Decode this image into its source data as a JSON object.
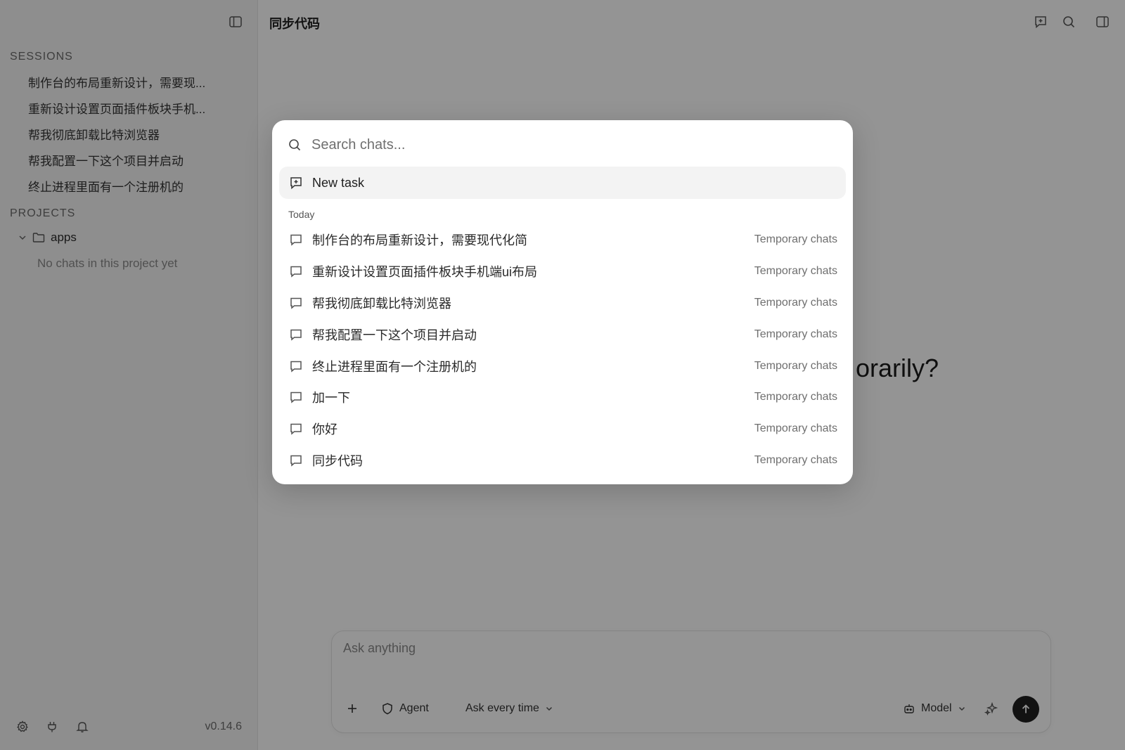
{
  "sidebar": {
    "sessions_title": "SESSIONS",
    "sessions": [
      {
        "title": "制作台的布局重新设计，需要现..."
      },
      {
        "title": "重新设计设置页面插件板块手机..."
      },
      {
        "title": "帮我彻底卸载比特浏览器"
      },
      {
        "title": "帮我配置一下这个项目并启动"
      },
      {
        "title": "终止进程里面有一个注册机的"
      }
    ],
    "projects_title": "PROJECTS",
    "project": {
      "name": "apps",
      "empty_text": "No chats in this project yet"
    },
    "version": "v0.14.6"
  },
  "main": {
    "title": "同步代码",
    "background_heading_fragment": "orarily?",
    "composer": {
      "placeholder": "Ask anything",
      "agent_label": "Agent",
      "permission_label": "Ask every time",
      "model_label": "Model"
    }
  },
  "search_modal": {
    "placeholder": "Search chats...",
    "new_task_label": "New task",
    "group_label": "Today",
    "chats": [
      {
        "title": "制作台的布局重新设计，需要现代化简",
        "tag": "Temporary chats"
      },
      {
        "title": "重新设计设置页面插件板块手机端ui布局",
        "tag": "Temporary chats"
      },
      {
        "title": "帮我彻底卸载比特浏览器",
        "tag": "Temporary chats"
      },
      {
        "title": "帮我配置一下这个项目并启动",
        "tag": "Temporary chats"
      },
      {
        "title": "终止进程里面有一个注册机的",
        "tag": "Temporary chats"
      },
      {
        "title": "加一下",
        "tag": "Temporary chats"
      },
      {
        "title": "你好",
        "tag": "Temporary chats"
      },
      {
        "title": "同步代码",
        "tag": "Temporary chats"
      }
    ]
  },
  "colors": {
    "overlay": "#000000",
    "send_button": "#1f1f1f",
    "sidebar_bg": "#f5f5f5",
    "new_task_bg": "#f3f3f3"
  },
  "icons": [
    "sidebar-toggle-icon",
    "settings-icon",
    "plug-icon",
    "bell-icon",
    "new-chat-icon",
    "search-icon",
    "panel-icon",
    "chevron-down-icon",
    "folder-icon",
    "plus-icon",
    "shield-icon",
    "robot-icon",
    "sparkle-icon",
    "arrow-up-icon",
    "chat-bubble-icon"
  ]
}
